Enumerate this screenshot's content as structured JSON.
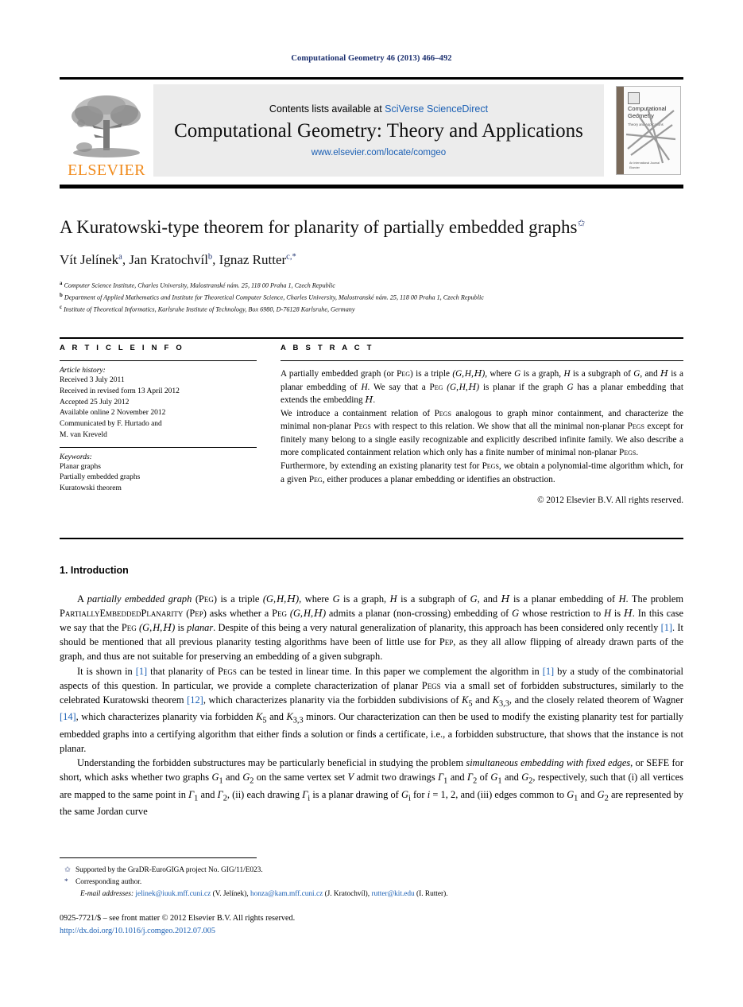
{
  "running_head": "Computational Geometry 46 (2013) 466–492",
  "masthead": {
    "contents_prefix": "Contents lists available at ",
    "contents_link": "SciVerse ScienceDirect",
    "journal_title": "Computational Geometry: Theory and Applications",
    "journal_url": "www.elsevier.com/locate/comgeo",
    "publisher_logo_text": "ELSEVIER",
    "cover": {
      "title_line1": "Computational",
      "title_line2": "Geometry",
      "subtitle": "Theory and Applications",
      "footer": "An International Journal\nElsevier"
    }
  },
  "title": {
    "text": "A Kuratowski-type theorem for planarity of partially embedded graphs",
    "footnote_marker": "✩"
  },
  "authors": [
    {
      "name": "Vít Jelínek",
      "sup": "a"
    },
    {
      "name": "Jan Kratochvíl",
      "sup": "b"
    },
    {
      "name": "Ignaz Rutter",
      "sup": "c,*"
    }
  ],
  "authors_line": "Vít Jelínek a, Jan Kratochvíl b, Ignaz Rutter c,*",
  "affiliations": [
    {
      "mark": "a",
      "text": "Computer Science Institute, Charles University, Malostranské nám. 25, 118 00 Praha 1, Czech Republic"
    },
    {
      "mark": "b",
      "text": "Department of Applied Mathematics and Institute for Theoretical Computer Science, Charles University, Malostranské nám. 25, 118 00 Praha 1, Czech Republic"
    },
    {
      "mark": "c",
      "text": "Institute of Theoretical Informatics, Karlsruhe Institute of Technology, Box 6980, D-76128 Karlsruhe, Germany"
    }
  ],
  "article_info": {
    "heading": "A R T I C L E   I N F O",
    "history_label": "Article history:",
    "history": [
      "Received 3 July 2011",
      "Received in revised form 13 April 2012",
      "Accepted 25 July 2012",
      "Available online 2 November 2012",
      "Communicated by F. Hurtado and",
      "M. van Kreveld"
    ],
    "keywords_label": "Keywords:",
    "keywords": [
      "Planar graphs",
      "Partially embedded graphs",
      "Kuratowski theorem"
    ]
  },
  "abstract": {
    "heading": "A B S T R A C T",
    "paragraphs": [
      "A partially embedded graph (or Peg) is a triple (G, H, H), where G is a graph, H is a subgraph of G, and H is a planar embedding of H. We say that a Peg (G, H, H) is planar if the graph G has a planar embedding that extends the embedding H.",
      "We introduce a containment relation of Pegs analogous to graph minor containment, and characterize the minimal non-planar Pegs with respect to this relation. We show that all the minimal non-planar Pegs except for finitely many belong to a single easily recognizable and explicitly described infinite family. We also describe a more complicated containment relation which only has a finite number of minimal non-planar Pegs.",
      "Furthermore, by extending an existing planarity test for Pegs, we obtain a polynomial-time algorithm which, for a given Peg, either produces a planar embedding or identifies an obstruction."
    ],
    "copyright": "© 2012 Elsevier B.V. All rights reserved."
  },
  "body": {
    "section_heading": "1. Introduction",
    "paragraphs": [
      "A partially embedded graph (Peg) is a triple (G, H, H), where G is a graph, H is a subgraph of G, and H is a planar embedding of H. The problem PartiallyEmbeddedPlanarity (Pep) asks whether a Peg (G, H, H) admits a planar (non-crossing) embedding of G whose restriction to H is H. In this case we say that the Peg (G, H, H) is planar. Despite of this being a very natural generalization of planarity, this approach has been considered only recently [1]. It should be mentioned that all previous planarity testing algorithms have been of little use for Pep, as they all allow flipping of already drawn parts of the graph, and thus are not suitable for preserving an embedding of a given subgraph.",
      "It is shown in [1] that planarity of Pegs can be tested in linear time. In this paper we complement the algorithm in [1] by a study of the combinatorial aspects of this question. In particular, we provide a complete characterization of planar Pegs via a small set of forbidden substructures, similarly to the celebrated Kuratowski theorem [12], which characterizes planarity via the forbidden subdivisions of K5 and K3,3, and the closely related theorem of Wagner [14], which characterizes planarity via forbidden K5 and K3,3 minors. Our characterization can then be used to modify the existing planarity test for partially embedded graphs into a certifying algorithm that either finds a solution or finds a certificate, i.e., a forbidden substructure, that shows that the instance is not planar.",
      "Understanding the forbidden substructures may be particularly beneficial in studying the problem simultaneous embedding with fixed edges, or SEFE for short, which asks whether two graphs G1 and G2 on the same vertex set V admit two drawings Γ1 and Γ2 of G1 and G2, respectively, such that (i) all vertices are mapped to the same point in Γ1 and Γ2, (ii) each drawing Γi is a planar drawing of Gi for i = 1, 2, and (iii) edges common to G1 and G2 are represented by the same Jordan curve"
    ]
  },
  "footnotes": {
    "star_mark": "✩",
    "star_text": "Supported by the GraDR-EuroGIGA project No. GIG/11/E023.",
    "asterisk_mark": "*",
    "asterisk_text": "Corresponding author.",
    "email_label": "E-mail addresses:",
    "emails": [
      {
        "address": "jelinek@iuuk.mff.cuni.cz",
        "owner": "(V. Jelínek)"
      },
      {
        "address": "honza@kam.mff.cuni.cz",
        "owner": "(J. Kratochvíl)"
      },
      {
        "address": "rutter@kit.edu",
        "owner": "(I. Rutter)"
      }
    ]
  },
  "footer": {
    "issn_line": "0925-7721/$ – see front matter © 2012 Elsevier B.V. All rights reserved.",
    "doi": "http://dx.doi.org/10.1016/j.comgeo.2012.07.005"
  },
  "colors": {
    "link": "#1a5fb4",
    "runhead": "#1a2e6e",
    "elsevier_orange": "#f08a1b",
    "masthead_bg": "#ececec"
  }
}
